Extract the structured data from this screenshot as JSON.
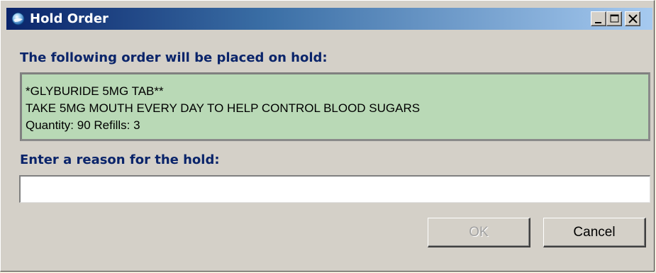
{
  "window": {
    "title": "Hold Order",
    "icon": "app-globe-icon",
    "controls": {
      "minimize": "minimize-icon",
      "maximize": "maximize-icon",
      "close": "close-icon"
    }
  },
  "order_section": {
    "label": "The following order will be placed on hold:",
    "lines": [
      "*GLYBURIDE 5MG TAB**",
      "TAKE 5MG MOUTH EVERY DAY TO HELP CONTROL BLOOD SUGARS",
      "Quantity: 90 Refills: 3"
    ],
    "background_color": "#b9d9b6"
  },
  "reason_section": {
    "label": "Enter a reason for the hold:",
    "value": "",
    "placeholder": ""
  },
  "buttons": {
    "ok_label": "OK",
    "ok_enabled": false,
    "cancel_label": "Cancel"
  },
  "colors": {
    "title_gradient_start": "#0a246a",
    "title_gradient_end": "#a6caf0",
    "label_color": "#0a246a",
    "dialog_background": "#d4d0c8"
  }
}
